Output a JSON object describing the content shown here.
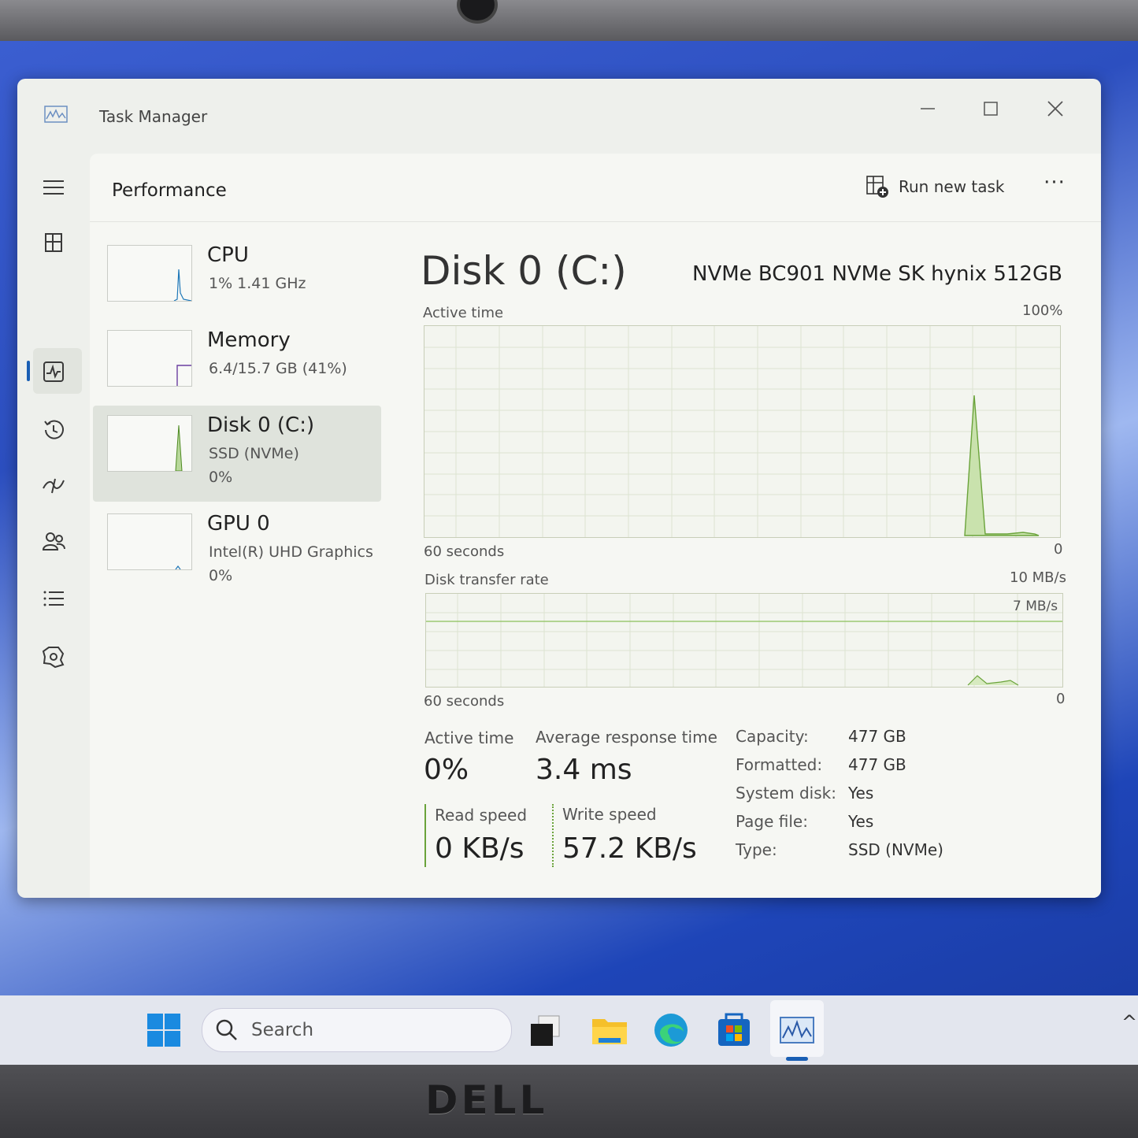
{
  "window": {
    "title": "Task Manager"
  },
  "header": {
    "page_title": "Performance",
    "run_new_task": "Run new task",
    "more": "···"
  },
  "resources": [
    {
      "name": "CPU",
      "line1": "1%  1.41 GHz",
      "line2": ""
    },
    {
      "name": "Memory",
      "line1": "6.4/15.7 GB (41%)",
      "line2": ""
    },
    {
      "name": "Disk 0 (C:)",
      "line1": "SSD (NVMe)",
      "line2": "0%"
    },
    {
      "name": "GPU 0",
      "line1": "Intel(R) UHD Graphics",
      "line2": "0%"
    }
  ],
  "detail": {
    "title": "Disk 0 (C:)",
    "model": "NVMe BC901 NVMe SK hynix 512GB",
    "active_chart": {
      "label": "Active time",
      "max_label": "100%",
      "time_label": "60 seconds",
      "min_label": "0"
    },
    "transfer_chart": {
      "label": "Disk transfer rate",
      "max_label": "10 MB/s",
      "mid_label": "7 MB/s",
      "time_label": "60 seconds",
      "min_label": "0"
    },
    "stats": {
      "active_time_label": "Active time",
      "active_time_value": "0%",
      "avg_response_label": "Average response time",
      "avg_response_value": "3.4 ms",
      "read_label": "Read speed",
      "read_value": "0 KB/s",
      "write_label": "Write speed",
      "write_value": "57.2 KB/s"
    },
    "properties": [
      {
        "label": "Capacity:",
        "value": "477 GB"
      },
      {
        "label": "Formatted:",
        "value": "477 GB"
      },
      {
        "label": "System disk:",
        "value": "Yes"
      },
      {
        "label": "Page file:",
        "value": "Yes"
      },
      {
        "label": "Type:",
        "value": "SSD (NVMe)"
      }
    ]
  },
  "taskbar": {
    "search_placeholder": "Search"
  },
  "brand": "DELL",
  "colors": {
    "accent": "#1a5fb4",
    "disk_graph": "#7ab648"
  }
}
